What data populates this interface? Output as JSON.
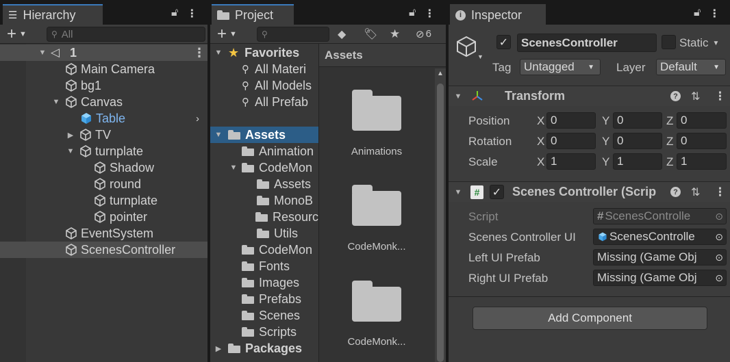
{
  "hierarchy": {
    "tab_label": "Hierarchy",
    "search_placeholder": "All",
    "scene": "1",
    "items": [
      {
        "label": "Main Camera"
      },
      {
        "label": "bg1"
      },
      {
        "label": "Canvas"
      },
      {
        "label": "Table"
      },
      {
        "label": "TV"
      },
      {
        "label": "turnplate"
      },
      {
        "label": "Shadow"
      },
      {
        "label": "round"
      },
      {
        "label": "turnplate"
      },
      {
        "label": "pointer"
      },
      {
        "label": "EventSystem"
      },
      {
        "label": "ScenesController"
      }
    ]
  },
  "project": {
    "tab_label": "Project",
    "hidden_count": "6",
    "favorites_label": "Favorites",
    "favorites": [
      {
        "label": "All Materi"
      },
      {
        "label": "All Models"
      },
      {
        "label": "All Prefab"
      }
    ],
    "assets_label": "Assets",
    "tree": [
      {
        "label": "Animation"
      },
      {
        "label": "CodeMon"
      },
      {
        "label": "Assets"
      },
      {
        "label": "MonoB"
      },
      {
        "label": "Resourc"
      },
      {
        "label": "Utils"
      },
      {
        "label": "CodeMon"
      },
      {
        "label": "Fonts"
      },
      {
        "label": "Images"
      },
      {
        "label": "Prefabs"
      },
      {
        "label": "Scenes"
      },
      {
        "label": "Scripts"
      }
    ],
    "packages_label": "Packages",
    "breadcrumb": "Assets",
    "grid": [
      {
        "label": "Animations"
      },
      {
        "label": "CodeMonk..."
      },
      {
        "label": "CodeMonk..."
      }
    ]
  },
  "inspector": {
    "tab_label": "Inspector",
    "object_name": "ScenesController",
    "static_label": "Static",
    "tag_label": "Tag",
    "tag_value": "Untagged",
    "layer_label": "Layer",
    "layer_value": "Default",
    "transform": {
      "title": "Transform",
      "rows": [
        {
          "label": "Position",
          "x": "0",
          "y": "0",
          "z": "0"
        },
        {
          "label": "Rotation",
          "x": "0",
          "y": "0",
          "z": "0"
        },
        {
          "label": "Scale",
          "x": "1",
          "y": "1",
          "z": "1"
        }
      ],
      "axis_x": "X",
      "axis_y": "Y",
      "axis_z": "Z"
    },
    "script_component": {
      "title": "Scenes Controller (Scrip",
      "rows": [
        {
          "label": "Script",
          "value": "ScenesControlle"
        },
        {
          "label": "Scenes Controller UI",
          "value": "ScenesControlle"
        },
        {
          "label": "Left UI Prefab",
          "value": "Missing (Game Obj"
        },
        {
          "label": "Right UI Prefab",
          "value": "Missing (Game Obj"
        }
      ]
    },
    "add_component_label": "Add Component"
  }
}
